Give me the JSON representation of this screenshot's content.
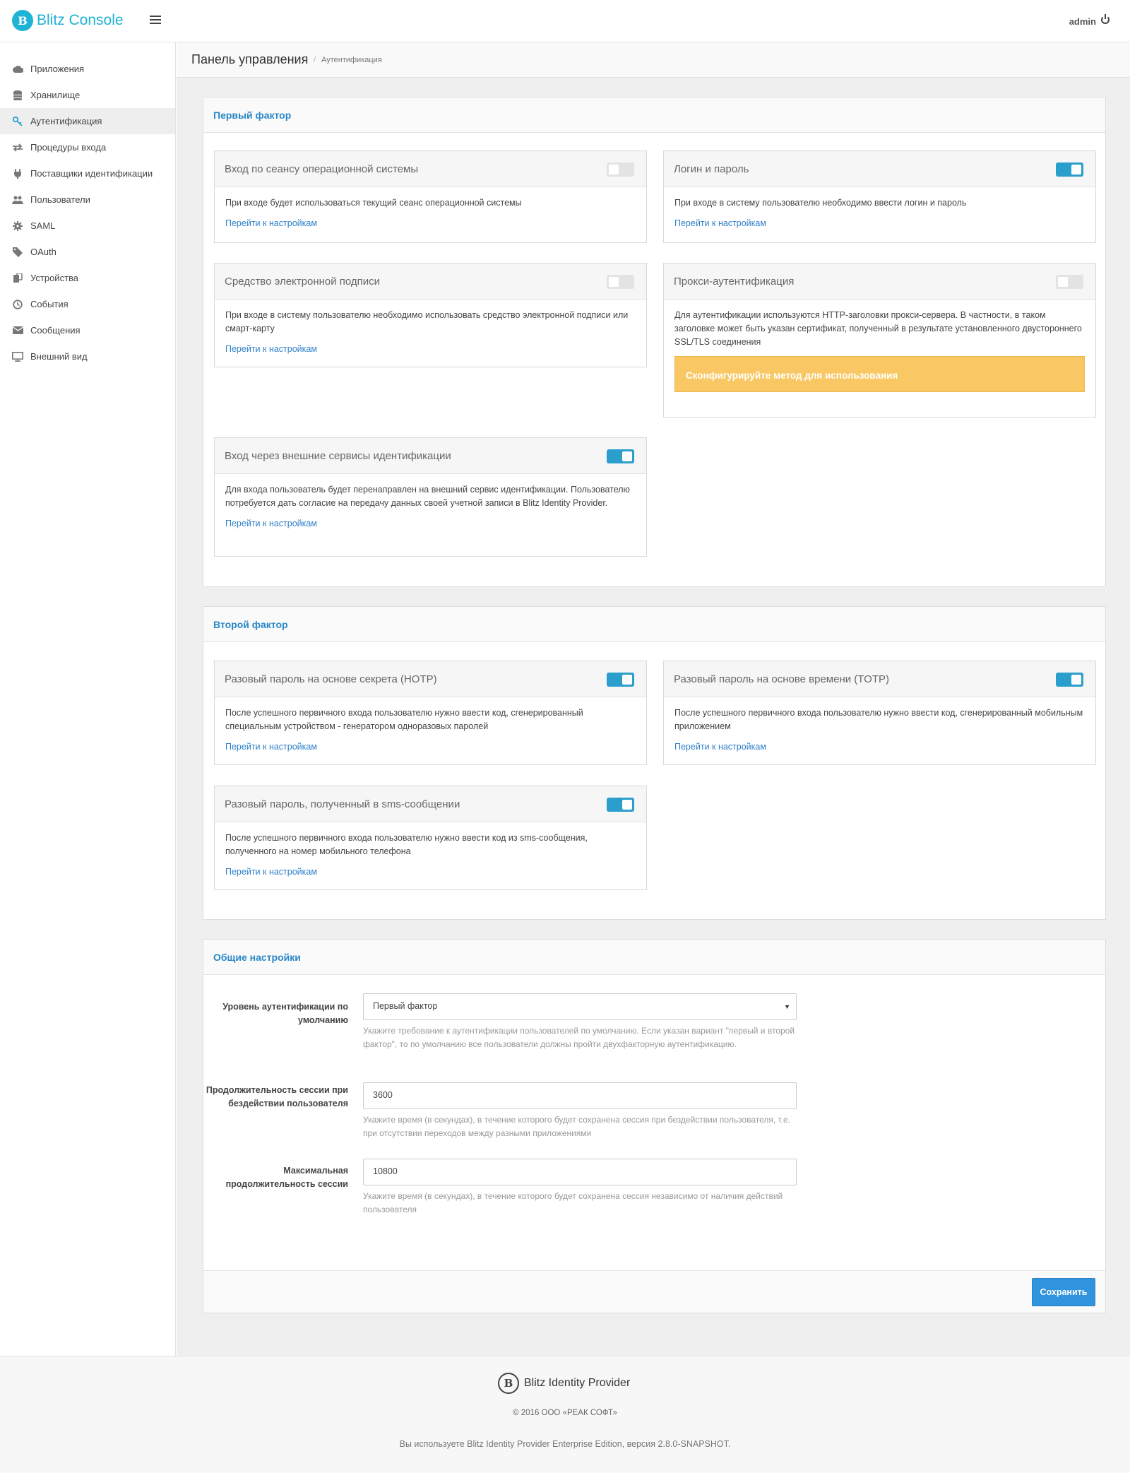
{
  "header": {
    "brand": "Blitz Console",
    "logo_letter": "B",
    "user": "admin"
  },
  "sidebar": {
    "items": [
      {
        "label": "Приложения",
        "icon": "cloud-icon"
      },
      {
        "label": "Хранилище",
        "icon": "database-icon"
      },
      {
        "label": "Аутентификация",
        "icon": "key-icon",
        "active": true
      },
      {
        "label": "Процедуры входа",
        "icon": "exchange-icon"
      },
      {
        "label": "Поставщики идентификации",
        "icon": "plug-icon"
      },
      {
        "label": "Пользователи",
        "icon": "users-icon"
      },
      {
        "label": "SAML",
        "icon": "gear-icon"
      },
      {
        "label": "OAuth",
        "icon": "tag-icon"
      },
      {
        "label": "Устройства",
        "icon": "devices-icon"
      },
      {
        "label": "События",
        "icon": "clock-icon"
      },
      {
        "label": "Сообщения",
        "icon": "envelope-icon"
      },
      {
        "label": "Внешний вид",
        "icon": "monitor-icon"
      }
    ]
  },
  "breadcrumb": {
    "title": "Панель управления",
    "separator": "/",
    "current": "Аутентификация"
  },
  "first_factor": {
    "title": "Первый фактор",
    "cards": [
      {
        "title": "Вход по сеансу операционной системы",
        "enabled": false,
        "text": "При входе будет использоваться текущий сеанс операционной системы",
        "link": "Перейти к настройкам"
      },
      {
        "title": "Логин и пароль",
        "enabled": true,
        "text": "При входе в систему пользователю необходимо ввести логин и пароль",
        "link": "Перейти к настройкам"
      },
      {
        "title": "Средство электронной подписи",
        "enabled": false,
        "text": "При входе в систему пользователю необходимо использовать средство электронной подписи или смарт-карту",
        "link": "Перейти к настройкам"
      },
      {
        "title": "Прокси-аутентификация",
        "enabled": false,
        "text": "Для аутентификации используются HTTP-заголовки прокси-сервера. В частности, в таком заголовке может быть указан сертификат, полученный в результате установленного двустороннего SSL/TLS соединения",
        "warning": "Сконфигурируйте метод для использования"
      },
      {
        "title": "Вход через внешние сервисы идентификации",
        "enabled": true,
        "text": "Для входа пользователь будет перенаправлен на внешний сервис идентификации. Пользователю потребуется дать согласие на передачу данных своей учетной записи в Blitz Identity Provider.",
        "link": "Перейти к настройкам"
      }
    ]
  },
  "second_factor": {
    "title": "Второй фактор",
    "cards": [
      {
        "title": "Разовый пароль на основе секрета (HOTP)",
        "enabled": true,
        "text": "После успешного первичного входа пользователю нужно ввести код, сгенерированный специальным устройством - генератором одноразовых паролей",
        "link": "Перейти к настройкам"
      },
      {
        "title": "Разовый пароль на основе времени (TOTP)",
        "enabled": true,
        "text": "После успешного первичного входа пользователю нужно ввести код, сгенерированный мобильным приложением",
        "link": "Перейти к настройкам"
      },
      {
        "title": "Разовый пароль, полученный в sms-сообщении",
        "enabled": true,
        "text": "После успешного первичного входа пользователю нужно ввести код из sms-сообщения, полученного на номер мобильного телефона",
        "link": "Перейти к настройкам"
      }
    ]
  },
  "general": {
    "title": "Общие настройки",
    "level": {
      "label": "Уровень аутентификации по умолчанию",
      "value": "Первый фактор",
      "help": "Укажите требование к аутентификации пользователей по умолчанию. Если указан вариант \"первый и второй фактор\", то по умолчанию все пользователи должны пройти двухфакторную аутентификацию."
    },
    "idle": {
      "label": "Продолжительность сессии при бездействии пользователя",
      "value": "3600",
      "help": "Укажите время (в секундах), в течение которого будет сохранена сессия при бездействии пользователя, т.е. при отсутствии переходов между разными приложениями"
    },
    "max": {
      "label": "Максимальная продолжительность сессии",
      "value": "10800",
      "help": "Укажите время (в секундах), в течение которого будет сохранена сессия независимо от наличия действий пользователя"
    },
    "save": "Сохранить"
  },
  "footer": {
    "product": "Blitz Identity Provider",
    "copyright": "© 2016 ООО «РЕАК СОФТ»",
    "version": "Вы используете Blitz Identity Provider Enterprise Edition, версия 2.8.0-SNAPSHOT."
  }
}
